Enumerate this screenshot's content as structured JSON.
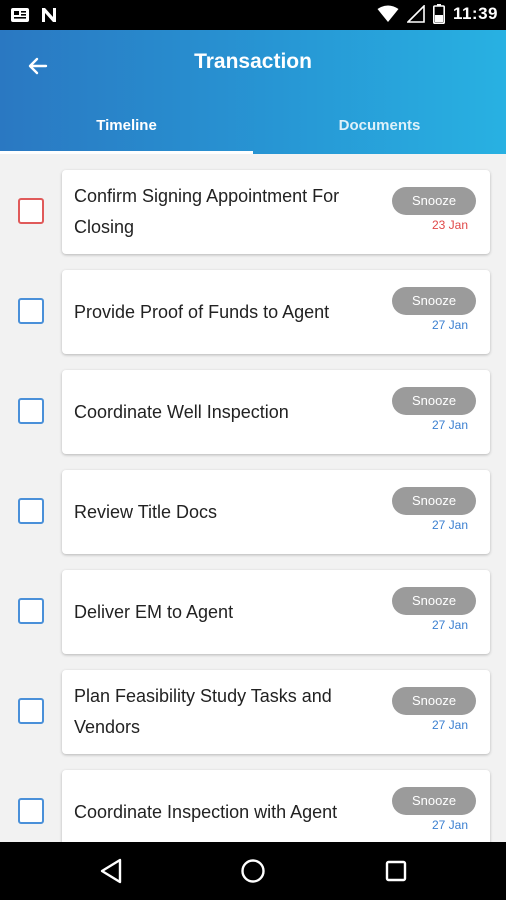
{
  "status_bar": {
    "time": "11:39",
    "icons": [
      "notification-card-icon",
      "n-app-icon",
      "wifi-icon",
      "signal-icon",
      "battery-icon"
    ]
  },
  "header": {
    "title": "Transaction",
    "tabs": [
      {
        "label": "Timeline",
        "active": true
      },
      {
        "label": "Documents",
        "active": false
      }
    ]
  },
  "colors": {
    "header_gradient": [
      "#2a78c2",
      "#28b1e2"
    ],
    "checkbox": "#4a90d9",
    "overdue": "#e04848",
    "snooze_bg": "#9b9b9b"
  },
  "tasks": [
    {
      "title": "Confirm Signing Appointment For Closing",
      "snooze_label": "Snooze",
      "date": "23 Jan",
      "overdue": true
    },
    {
      "title": "Provide Proof of Funds to Agent",
      "snooze_label": "Snooze",
      "date": "27 Jan",
      "overdue": false
    },
    {
      "title": "Coordinate Well Inspection",
      "snooze_label": "Snooze",
      "date": "27 Jan",
      "overdue": false
    },
    {
      "title": "Review Title Docs",
      "snooze_label": "Snooze",
      "date": "27 Jan",
      "overdue": false
    },
    {
      "title": "Deliver EM to Agent",
      "snooze_label": "Snooze",
      "date": "27 Jan",
      "overdue": false
    },
    {
      "title": "Plan Feasibility Study Tasks and Vendors",
      "snooze_label": "Snooze",
      "date": "27 Jan",
      "overdue": false
    },
    {
      "title": "Coordinate Inspection with Agent",
      "snooze_label": "Snooze",
      "date": "27 Jan",
      "overdue": false
    }
  ]
}
